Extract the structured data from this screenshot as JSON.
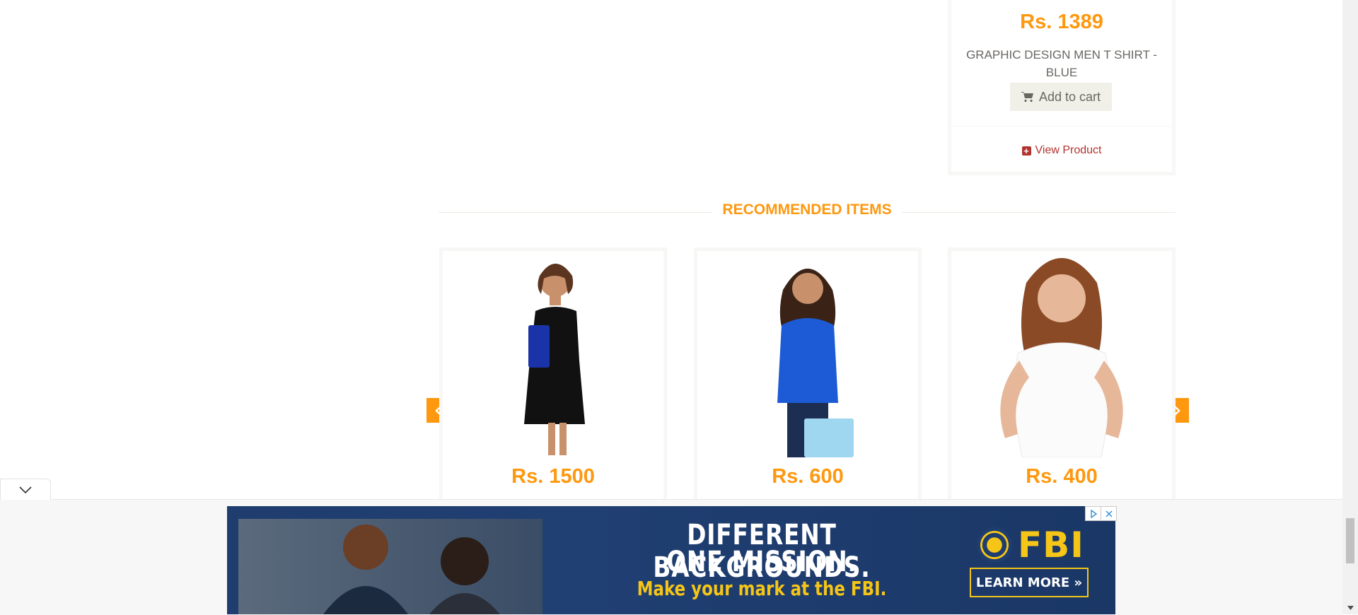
{
  "top_product": {
    "price": "Rs. 1389",
    "name": "GRAPHIC DESIGN MEN T SHIRT - BLUE",
    "add_to_cart": "Add to cart",
    "view_product": "View Product"
  },
  "recommended": {
    "title": "RECOMMENDED ITEMS",
    "items": [
      {
        "price": "Rs. 1500",
        "image": "woman-black-dress"
      },
      {
        "price": "Rs. 600",
        "image": "woman-blue-top"
      },
      {
        "price": "Rs. 400",
        "image": "woman-white-tshirt"
      }
    ]
  },
  "ad": {
    "headline_1": "DIFFERENT BACKGROUNDS.",
    "headline_2": "ONE MISSION.",
    "subline": "Make your mark at the FBI.",
    "brand": "FBI",
    "cta": "LEARN MORE »"
  },
  "colors": {
    "accent": "#fe980f",
    "link": "#b3342e",
    "ad_navy": "#1f3d6e",
    "ad_gold": "#f5c518"
  }
}
